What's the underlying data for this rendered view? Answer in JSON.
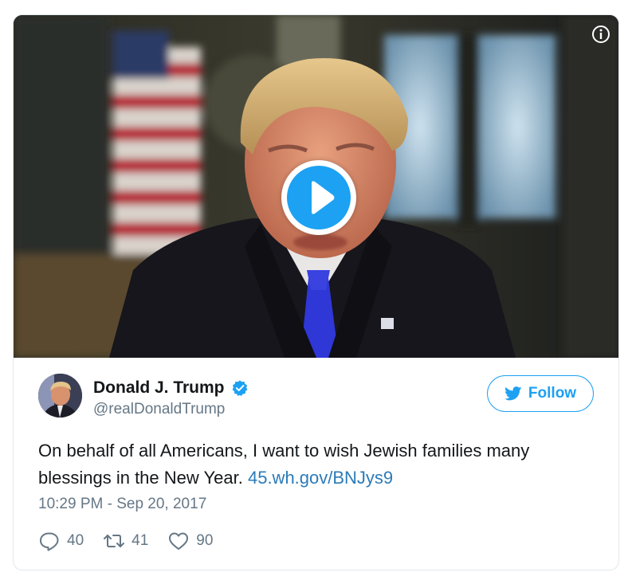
{
  "media": {
    "play_button_icon": "play-icon",
    "info_icon": "info-icon"
  },
  "author": {
    "name": "Donald J. Trump",
    "handle": "@realDonaldTrump",
    "verified": true
  },
  "follow_button": {
    "label": "Follow",
    "icon": "twitter-bird-icon"
  },
  "tweet": {
    "text_part1": "On behalf of all Americans, I want to wish Jewish families many blessings in the New Year.",
    "link_text": "45.wh.gov/BNJys9",
    "timestamp": "10:29 PM - Sep 20, 2017"
  },
  "actions": {
    "replies": "40",
    "retweets": "41",
    "likes": "90"
  },
  "colors": {
    "accent": "#1da1f2",
    "link": "#2b7bb9",
    "muted": "#657786",
    "text": "#14171a",
    "border": "#e1e8ed"
  }
}
